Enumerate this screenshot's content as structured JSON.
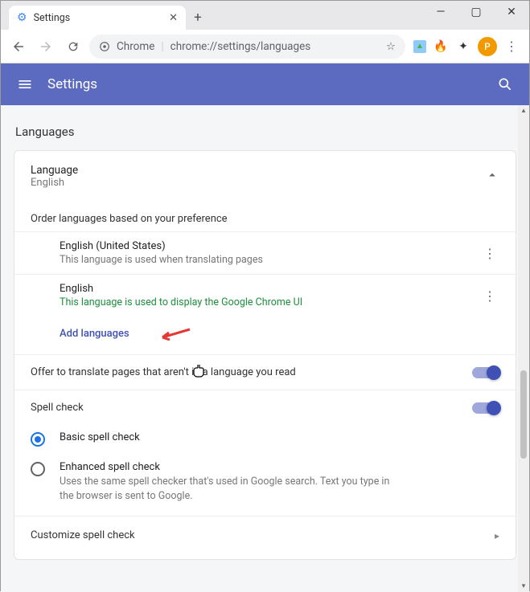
{
  "window": {
    "tab_title": "Settings",
    "minimize": "—",
    "maximize": "▢",
    "close": "✕",
    "newtab": "+"
  },
  "toolbar": {
    "chrome_label": "Chrome",
    "url": "chrome://settings/languages",
    "avatar_letter": "P"
  },
  "header": {
    "title": "Settings"
  },
  "page": {
    "section_title": "Languages",
    "language_card": {
      "title": "Language",
      "value": "English",
      "order_hint": "Order languages based on your preference",
      "items": [
        {
          "name": "English (United States)",
          "sub": "This language is used when translating pages",
          "sub_green": false
        },
        {
          "name": "English",
          "sub": "This language is used to display the Google Chrome UI",
          "sub_green": true
        }
      ],
      "add_label": "Add languages",
      "translate_offer": "Offer to translate pages that aren't in a language you read"
    },
    "spellcheck": {
      "title": "Spell check",
      "options": [
        {
          "label": "Basic spell check",
          "sub": "",
          "checked": true
        },
        {
          "label": "Enhanced spell check",
          "sub": "Uses the same spell checker that's used in Google search. Text you type in the browser is sent to Google.",
          "checked": false
        }
      ],
      "customize": "Customize spell check"
    }
  }
}
